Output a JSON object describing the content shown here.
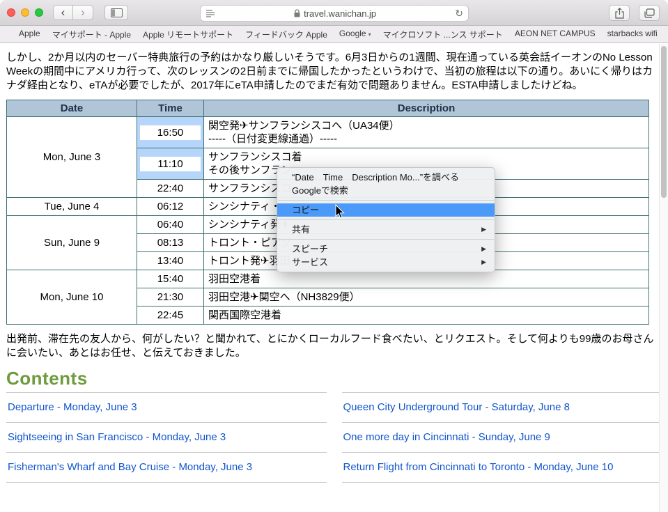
{
  "toolbar": {
    "back_icon": "‹",
    "forward_icon": "›",
    "url": "travel.wanichan.jp",
    "refresh_icon": "↻"
  },
  "bookmarks_bar": {
    "items": [
      {
        "label": "Apple"
      },
      {
        "label": "マイサポート - Apple"
      },
      {
        "label": "Apple リモートサポート"
      },
      {
        "label": "フィードバック Apple"
      },
      {
        "label": "Google",
        "dropdown": true
      },
      {
        "label": "マイクロソフト ...ンス サポート"
      },
      {
        "label": "AEON NET CAMPUS"
      },
      {
        "label": "starbacks wifi"
      }
    ],
    "overflow_icon": "»",
    "add_icon": "+"
  },
  "content": {
    "paragraph1": "しかし、2か月以内のセーバー特典旅行の予約はかなり厳しいそうです。6月3日からの1週間、現在通っている英会話イーオンのNo Lesson Weekの期間中にアメリカ行って、次のレッスンの2日前までに帰国したかったというわけで、当初の旅程は以下の通り。あいにく帰りはカナダ経由となり、eTAが必要でしたが、2017年にeTA申請したのでまだ有効で問題ありません。ESTA申請しましたけどね。",
    "paragraph2": "出発前、滞在先の友人から、何がしたい？と聞かれて、とにかくローカルフード食べたい、とリクエスト。そして何よりも99歳のお母さんに会いたい、あとはお任せ、と伝えておきました。",
    "contents_heading": "Contents",
    "toc_left": [
      "Departure - Monday, June 3",
      "Sightseeing in San Francisco - Monday, June 3",
      "Fisherman's Wharf and Bay Cruise - Monday, June 3"
    ],
    "toc_right": [
      "Queen City Underground Tour - Saturday, June 8",
      "One more day in Cincinnati - Sunday, June 9",
      "Return Flight from Cincinnati to Toronto - Monday, June 10"
    ]
  },
  "itinerary_table": {
    "headers": [
      "Date",
      "Time",
      "Description"
    ],
    "rows": [
      {
        "date": "Mon, June 3",
        "date_rowspan": 3,
        "time": "16:50",
        "desc": [
          "関空発✈サンフランシスコへ（UA34便）",
          "-----（日付変更線通過）-----"
        ],
        "selected": true
      },
      {
        "time": "11:10",
        "desc": [
          "サンフランシスコ着",
          "その後サンフラン"
        ],
        "selected": true
      },
      {
        "time": "22:40",
        "desc": [
          "サンフランシスコ"
        ],
        "selected": true,
        "time_selected": true
      },
      {
        "date": "Tue, June 4",
        "date_rowspan": 1,
        "time": "06:12",
        "desc": [
          "シンシナティ・"
        ]
      },
      {
        "date": "Sun, June 9",
        "date_rowspan": 3,
        "time": "06:40",
        "desc": [
          "シンシナティ発✈"
        ]
      },
      {
        "time": "08:13",
        "desc": [
          "トロント・ピアソ"
        ]
      },
      {
        "time": "13:40",
        "desc": [
          "トロント発✈羽田"
        ]
      },
      {
        "date": "Mon, June 10",
        "date_rowspan": 3,
        "time": "15:40",
        "desc": [
          "羽田空港着"
        ]
      },
      {
        "time": "21:30",
        "desc": [
          "羽田空港✈関空へ（NH3829便）"
        ]
      },
      {
        "time": "22:45",
        "desc": [
          "関西国際空港着"
        ]
      }
    ]
  },
  "context_menu": {
    "items": [
      {
        "type": "normal",
        "label": "“Date Time Description Mo...”を調べる"
      },
      {
        "type": "normal",
        "label": "Googleで検索"
      },
      {
        "type": "separator"
      },
      {
        "type": "highlighted",
        "label": "コピー"
      },
      {
        "type": "separator"
      },
      {
        "type": "submenu",
        "label": "共有"
      },
      {
        "type": "separator"
      },
      {
        "type": "submenu",
        "label": "スピーチ"
      },
      {
        "type": "submenu",
        "label": "サービス"
      }
    ]
  },
  "colors": {
    "selection_blue": "#b5d6fa",
    "menu_highlight": "#4b9af9",
    "table_border": "#3f7070",
    "table_header_bg": "#b0c6d8",
    "link_blue": "#1155cc",
    "heading_green": "#6f9b3f"
  }
}
